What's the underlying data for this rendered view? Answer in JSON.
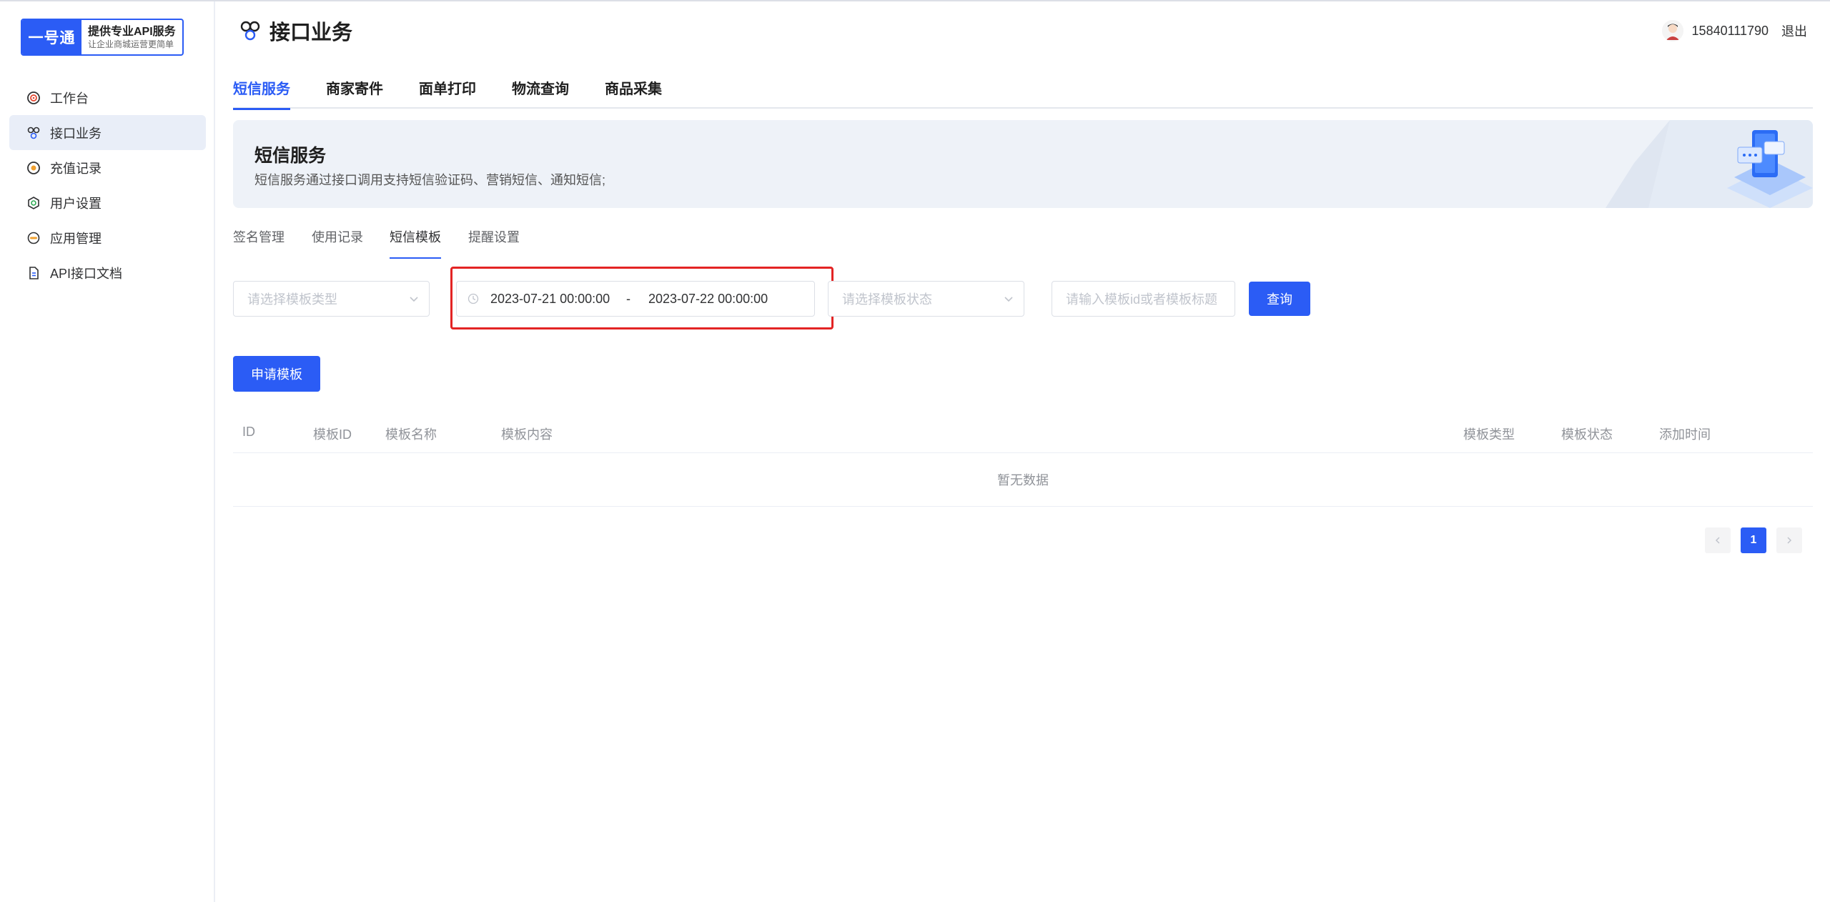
{
  "logo": {
    "brand": "一号通",
    "title": "提供专业API服务",
    "subtitle": "让企业商城运营更简单"
  },
  "sidebar": {
    "items": [
      {
        "label": "工作台",
        "icon": "target-icon",
        "active": false
      },
      {
        "label": "接口业务",
        "icon": "cluster-icon",
        "active": true
      },
      {
        "label": "充值记录",
        "icon": "coin-icon",
        "active": false
      },
      {
        "label": "用户设置",
        "icon": "user-settings-icon",
        "active": false
      },
      {
        "label": "应用管理",
        "icon": "app-manage-icon",
        "active": false
      },
      {
        "label": "API接口文档",
        "icon": "document-icon",
        "active": false
      }
    ]
  },
  "header": {
    "title": "接口业务",
    "icon": "cluster-icon"
  },
  "user": {
    "phone": "15840111790",
    "logout_label": "退出"
  },
  "main_tabs": [
    {
      "label": "短信服务",
      "active": true
    },
    {
      "label": "商家寄件",
      "active": false
    },
    {
      "label": "面单打印",
      "active": false
    },
    {
      "label": "物流查询",
      "active": false
    },
    {
      "label": "商品采集",
      "active": false
    }
  ],
  "banner": {
    "title": "短信服务",
    "description": "短信服务通过接口调用支持短信验证码、营销短信、通知短信;"
  },
  "sub_tabs": [
    {
      "label": "签名管理",
      "active": false
    },
    {
      "label": "使用记录",
      "active": false
    },
    {
      "label": "短信模板",
      "active": true
    },
    {
      "label": "提醒设置",
      "active": false
    }
  ],
  "filters": {
    "type_placeholder": "请选择模板类型",
    "date_start": "2023-07-21 00:00:00",
    "date_separator": "-",
    "date_end": "2023-07-22 00:00:00",
    "status_placeholder": "请选择模板状态",
    "keyword_placeholder": "请输入模板id或者模板标题",
    "query_label": "查询"
  },
  "apply_button_label": "申请模板",
  "table": {
    "columns": [
      "ID",
      "模板ID",
      "模板名称",
      "模板内容",
      "模板类型",
      "模板状态",
      "添加时间"
    ],
    "empty_text": "暂无数据"
  },
  "pagination": {
    "current_page": "1",
    "prev_icon": "chevron-left-icon",
    "next_icon": "chevron-right-icon"
  },
  "colors": {
    "primary": "#2b5cf5",
    "highlight": "#e32424",
    "sidebar_active_bg": "#e9eef8"
  }
}
